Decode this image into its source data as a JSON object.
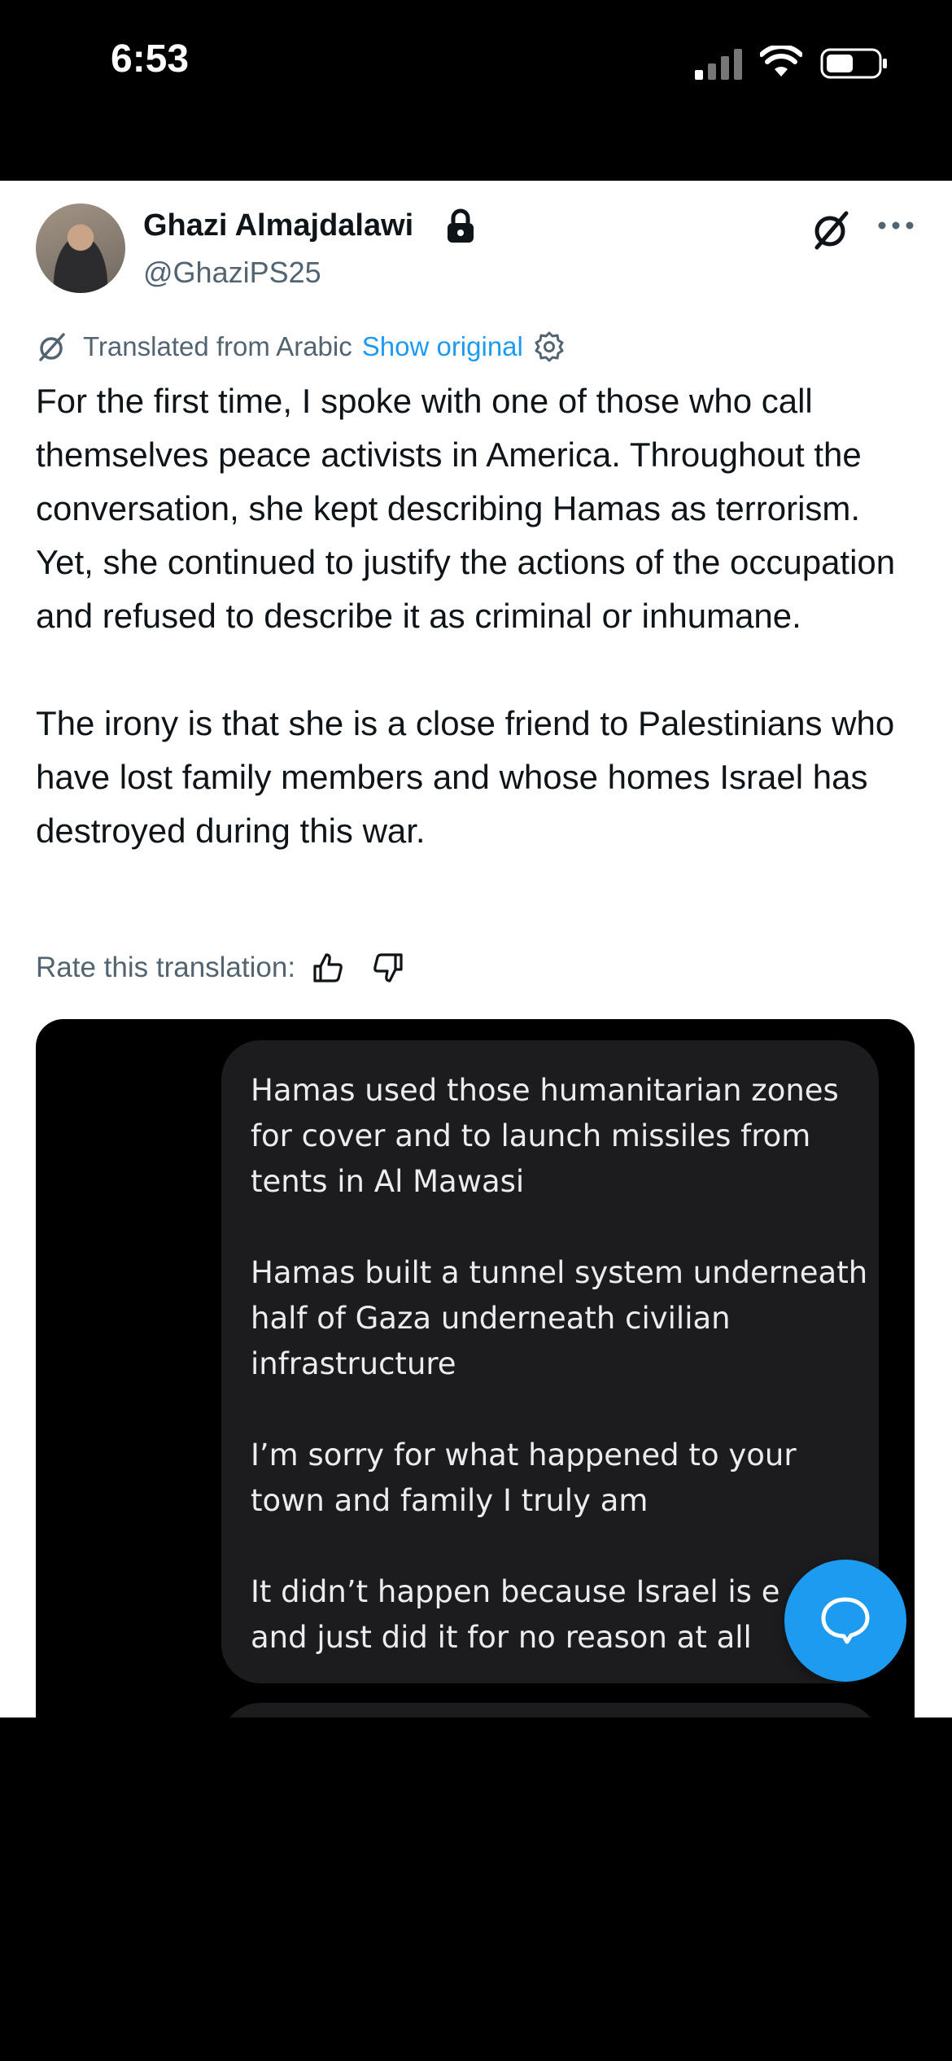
{
  "status_bar": {
    "time": "6:53"
  },
  "post": {
    "author_name": "Ghazi Almajdalawi",
    "handle": "@GhaziPS25",
    "translated_label": "Translated from Arabic",
    "show_original": "Show original",
    "text": "For the first time, I spoke with one of those who call themselves peace activists in America. Throughout the conversation, she kept describing Hamas as terrorism. Yet, she continued to justify the actions of the occupation and refused to describe it as criminal or inhumane.\n\nThe irony is that she is a close friend to Palestinians who have lost family members and whose homes Israel has destroyed during this war.",
    "rate_label": "Rate this translation:"
  },
  "screenshot": {
    "message_text": "Hamas used those humanitarian zones for cover and to launch missiles from tents in Al Mawasi\n\nHamas built a tunnel system underneath half of Gaza underneath civilian infrastructure\n\nI’m sorry for what happened to your town and family I truly am\n\nIt didn’t happen because Israel is e\nand just did it for no reason at all"
  },
  "icons": {
    "lock": "lock-icon",
    "grok": "grok-icon",
    "more": "more-icon",
    "translate": "translate-icon",
    "settings": "gear-icon",
    "like": "thumbs-up-icon",
    "dislike": "thumbs-down-icon",
    "compose": "chat-bubble-icon"
  },
  "colors": {
    "accent": "#1d9bf0",
    "text": "#0f1419",
    "secondary": "#536471"
  }
}
